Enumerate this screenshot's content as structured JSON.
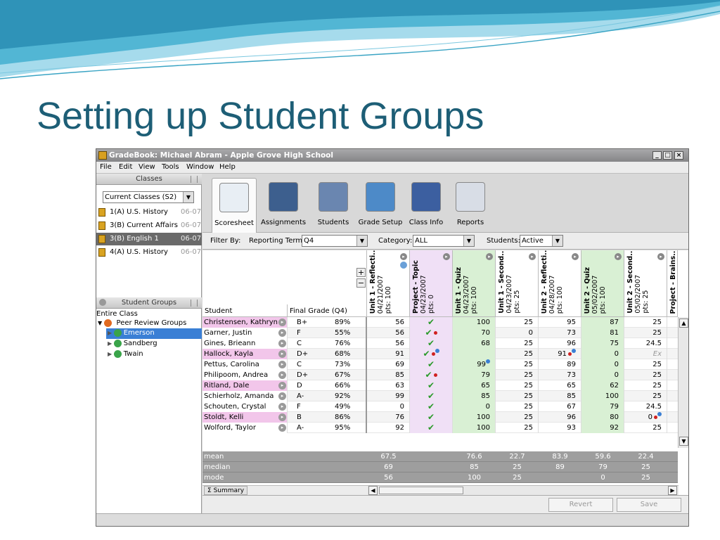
{
  "slide": {
    "title": "Setting up Student Groups",
    "colors": {
      "title": "#1d5e76",
      "wave_dark": "#3aa4c4",
      "wave_light": "#a6dbec"
    }
  },
  "window": {
    "title": "GradeBook: Michael Abram - Apple Grove High School",
    "controls": [
      "_",
      "□",
      "×"
    ]
  },
  "menu": [
    "File",
    "Edit",
    "View",
    "Tools",
    "Window",
    "Help"
  ],
  "classes": {
    "header": "Classes",
    "selector_value": "Current Classes (S2)",
    "items": [
      {
        "name": "1(A) U.S. History",
        "year": "06-07"
      },
      {
        "name": "3(B) Current Affairs",
        "year": "06-07"
      },
      {
        "name": "3(B) English 1",
        "year": "06-07"
      },
      {
        "name": "4(A) U.S. History",
        "year": "06-07"
      }
    ],
    "selected_index": 2
  },
  "student_groups": {
    "header": "Student Groups",
    "root": "Entire Class",
    "group_set": "Peer Review Groups",
    "groups": [
      "Emerson",
      "Sandberg",
      "Twain"
    ],
    "selected": "Emerson"
  },
  "toolbar": {
    "items": [
      {
        "label": "Scoresheet",
        "icon": "scoresheet-icon",
        "color": "#e8eef4"
      },
      {
        "label": "Assignments",
        "icon": "assignments-icon",
        "color": "#3d5f8e"
      },
      {
        "label": "Students",
        "icon": "students-icon",
        "color": "#6a86b0"
      },
      {
        "label": "Grade Setup",
        "icon": "grade-setup-icon",
        "color": "#4d8ac8"
      },
      {
        "label": "Class Info",
        "icon": "class-info-icon",
        "color": "#3c5fa0"
      },
      {
        "label": "Reports",
        "icon": "reports-icon",
        "color": "#d8dde6"
      }
    ],
    "active_index": 0
  },
  "filter": {
    "filter_by": "Filter By:",
    "term_label": "Reporting Term:",
    "term_value": "Q4",
    "category_label": "Category:",
    "category_value": "ALL",
    "students_label": "Students:",
    "students_value": "Active"
  },
  "grid": {
    "student_header": "Student",
    "final_grade_header": "Final Grade (Q4)",
    "columns": [
      {
        "title": "Unit 1 - Reflecti...",
        "date": "04/21/2007",
        "pts": "pts: 100",
        "bg": "#ffffff"
      },
      {
        "title": "Project - Topic",
        "date": "04/23/2007",
        "pts": "pts: 0",
        "bg": "#f0e0f6"
      },
      {
        "title": "Unit 1 - Quiz",
        "date": "04/23/2007",
        "pts": "pts: 100",
        "bg": "#d9f0d4"
      },
      {
        "title": "Unit 1 - Second...",
        "date": "04/23/2007",
        "pts": "pts: 25",
        "bg": "#ffffff"
      },
      {
        "title": "Unit 2 - Reflecti...",
        "date": "04/28/2007",
        "pts": "pts: 100",
        "bg": "#ffffff"
      },
      {
        "title": "Unit 2 - Quiz",
        "date": "05/02/2007",
        "pts": "pts: 100",
        "bg": "#d9f0d4"
      },
      {
        "title": "Unit 2 - Second...",
        "date": "05/02/2007",
        "pts": "pts: 25",
        "bg": "#ffffff"
      },
      {
        "title": "Project - Brains...",
        "date": "",
        "pts": "",
        "bg": "#ffffff"
      }
    ],
    "rows": [
      {
        "name": "Christensen, Kathryn",
        "hl": "pink",
        "grade": "B+",
        "pct": "89%",
        "scores": [
          "56",
          "✔",
          "100",
          "25",
          "95",
          "87",
          "25"
        ],
        "marks": [
          "",
          "",
          "",
          "",
          "",
          "",
          ""
        ]
      },
      {
        "name": "Garner, Justin",
        "hl": "",
        "grade": "F",
        "pct": "55%",
        "scores": [
          "56",
          "✔",
          "70",
          "0",
          "73",
          "81",
          "25"
        ],
        "marks": [
          "",
          "red",
          "",
          "",
          "",
          "",
          ""
        ]
      },
      {
        "name": "Gines, Brieann",
        "hl": "",
        "grade": "C",
        "pct": "76%",
        "scores": [
          "56",
          "✔",
          "68",
          "25",
          "96",
          "75",
          "24.5"
        ],
        "marks": [
          "",
          "",
          "",
          "",
          "",
          "",
          ""
        ]
      },
      {
        "name": "Hallock, Kayla",
        "hl": "pink",
        "grade": "D+",
        "pct": "68%",
        "scores": [
          "91",
          "✔",
          "",
          "25",
          "91",
          "0",
          "Ex"
        ],
        "marks": [
          "",
          "both",
          "",
          "",
          "both",
          "",
          ""
        ]
      },
      {
        "name": "Pettus, Carolina",
        "hl": "",
        "grade": "C",
        "pct": "73%",
        "scores": [
          "69",
          "✔",
          "99",
          "25",
          "89",
          "0",
          "25"
        ],
        "marks": [
          "",
          "",
          "blue",
          "",
          "",
          "",
          ""
        ]
      },
      {
        "name": "Philipoom, Andrea",
        "hl": "",
        "grade": "D+",
        "pct": "67%",
        "scores": [
          "85",
          "✔",
          "79",
          "25",
          "73",
          "0",
          "25"
        ],
        "marks": [
          "",
          "red",
          "",
          "",
          "",
          "",
          ""
        ]
      },
      {
        "name": "Ritland, Dale",
        "hl": "pink",
        "grade": "D",
        "pct": "66%",
        "scores": [
          "63",
          "✔",
          "65",
          "25",
          "65",
          "62",
          "25"
        ],
        "marks": [
          "",
          "",
          "",
          "",
          "",
          "",
          ""
        ]
      },
      {
        "name": "Schierholz, Amanda",
        "hl": "",
        "grade": "A-",
        "pct": "92%",
        "scores": [
          "99",
          "✔",
          "85",
          "25",
          "85",
          "100",
          "25"
        ],
        "marks": [
          "",
          "",
          "",
          "",
          "",
          "",
          ""
        ]
      },
      {
        "name": "Schouten, Crystal",
        "hl": "",
        "grade": "F",
        "pct": "49%",
        "scores": [
          "0",
          "✔",
          "0",
          "25",
          "67",
          "79",
          "24.5"
        ],
        "marks": [
          "",
          "",
          "",
          "",
          "",
          "",
          ""
        ]
      },
      {
        "name": "Stoldt, Kelli",
        "hl": "pink",
        "grade": "B",
        "pct": "86%",
        "scores": [
          "76",
          "✔",
          "100",
          "25",
          "96",
          "80",
          "0"
        ],
        "marks": [
          "",
          "",
          "",
          "",
          "",
          "",
          "both"
        ]
      },
      {
        "name": "Wolford, Taylor",
        "hl": "",
        "grade": "A-",
        "pct": "95%",
        "scores": [
          "92",
          "✔",
          "100",
          "25",
          "93",
          "92",
          "25"
        ],
        "marks": [
          "",
          "",
          "",
          "",
          "",
          "",
          ""
        ]
      }
    ],
    "stats": [
      {
        "label": "mean",
        "values": [
          "67.5",
          "",
          "76.6",
          "22.7",
          "83.9",
          "59.6",
          "22.4"
        ]
      },
      {
        "label": "median",
        "values": [
          "69",
          "",
          "85",
          "25",
          "89",
          "79",
          "25"
        ]
      },
      {
        "label": "mode",
        "values": [
          "56",
          "",
          "100",
          "25",
          "",
          "0",
          "25"
        ]
      }
    ],
    "summary_tab": "Summary"
  },
  "buttons": {
    "revert": "Revert",
    "save": "Save",
    "add": "+",
    "remove": "−"
  }
}
